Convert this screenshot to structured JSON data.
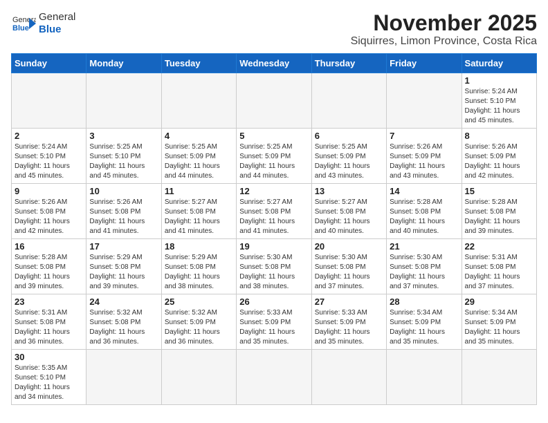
{
  "header": {
    "logo_general": "General",
    "logo_blue": "Blue",
    "month": "November 2025",
    "location": "Siquirres, Limon Province, Costa Rica"
  },
  "weekdays": [
    "Sunday",
    "Monday",
    "Tuesday",
    "Wednesday",
    "Thursday",
    "Friday",
    "Saturday"
  ],
  "rows": [
    [
      {
        "day": "",
        "info": ""
      },
      {
        "day": "",
        "info": ""
      },
      {
        "day": "",
        "info": ""
      },
      {
        "day": "",
        "info": ""
      },
      {
        "day": "",
        "info": ""
      },
      {
        "day": "",
        "info": ""
      },
      {
        "day": "1",
        "info": "Sunrise: 5:24 AM\nSunset: 5:10 PM\nDaylight: 11 hours\nand 45 minutes."
      }
    ],
    [
      {
        "day": "2",
        "info": "Sunrise: 5:24 AM\nSunset: 5:10 PM\nDaylight: 11 hours\nand 45 minutes."
      },
      {
        "day": "3",
        "info": "Sunrise: 5:25 AM\nSunset: 5:10 PM\nDaylight: 11 hours\nand 45 minutes."
      },
      {
        "day": "4",
        "info": "Sunrise: 5:25 AM\nSunset: 5:09 PM\nDaylight: 11 hours\nand 44 minutes."
      },
      {
        "day": "5",
        "info": "Sunrise: 5:25 AM\nSunset: 5:09 PM\nDaylight: 11 hours\nand 44 minutes."
      },
      {
        "day": "6",
        "info": "Sunrise: 5:25 AM\nSunset: 5:09 PM\nDaylight: 11 hours\nand 43 minutes."
      },
      {
        "day": "7",
        "info": "Sunrise: 5:26 AM\nSunset: 5:09 PM\nDaylight: 11 hours\nand 43 minutes."
      },
      {
        "day": "8",
        "info": "Sunrise: 5:26 AM\nSunset: 5:09 PM\nDaylight: 11 hours\nand 42 minutes."
      }
    ],
    [
      {
        "day": "9",
        "info": "Sunrise: 5:26 AM\nSunset: 5:08 PM\nDaylight: 11 hours\nand 42 minutes."
      },
      {
        "day": "10",
        "info": "Sunrise: 5:26 AM\nSunset: 5:08 PM\nDaylight: 11 hours\nand 41 minutes."
      },
      {
        "day": "11",
        "info": "Sunrise: 5:27 AM\nSunset: 5:08 PM\nDaylight: 11 hours\nand 41 minutes."
      },
      {
        "day": "12",
        "info": "Sunrise: 5:27 AM\nSunset: 5:08 PM\nDaylight: 11 hours\nand 41 minutes."
      },
      {
        "day": "13",
        "info": "Sunrise: 5:27 AM\nSunset: 5:08 PM\nDaylight: 11 hours\nand 40 minutes."
      },
      {
        "day": "14",
        "info": "Sunrise: 5:28 AM\nSunset: 5:08 PM\nDaylight: 11 hours\nand 40 minutes."
      },
      {
        "day": "15",
        "info": "Sunrise: 5:28 AM\nSunset: 5:08 PM\nDaylight: 11 hours\nand 39 minutes."
      }
    ],
    [
      {
        "day": "16",
        "info": "Sunrise: 5:28 AM\nSunset: 5:08 PM\nDaylight: 11 hours\nand 39 minutes."
      },
      {
        "day": "17",
        "info": "Sunrise: 5:29 AM\nSunset: 5:08 PM\nDaylight: 11 hours\nand 39 minutes."
      },
      {
        "day": "18",
        "info": "Sunrise: 5:29 AM\nSunset: 5:08 PM\nDaylight: 11 hours\nand 38 minutes."
      },
      {
        "day": "19",
        "info": "Sunrise: 5:30 AM\nSunset: 5:08 PM\nDaylight: 11 hours\nand 38 minutes."
      },
      {
        "day": "20",
        "info": "Sunrise: 5:30 AM\nSunset: 5:08 PM\nDaylight: 11 hours\nand 37 minutes."
      },
      {
        "day": "21",
        "info": "Sunrise: 5:30 AM\nSunset: 5:08 PM\nDaylight: 11 hours\nand 37 minutes."
      },
      {
        "day": "22",
        "info": "Sunrise: 5:31 AM\nSunset: 5:08 PM\nDaylight: 11 hours\nand 37 minutes."
      }
    ],
    [
      {
        "day": "23",
        "info": "Sunrise: 5:31 AM\nSunset: 5:08 PM\nDaylight: 11 hours\nand 36 minutes."
      },
      {
        "day": "24",
        "info": "Sunrise: 5:32 AM\nSunset: 5:08 PM\nDaylight: 11 hours\nand 36 minutes."
      },
      {
        "day": "25",
        "info": "Sunrise: 5:32 AM\nSunset: 5:09 PM\nDaylight: 11 hours\nand 36 minutes."
      },
      {
        "day": "26",
        "info": "Sunrise: 5:33 AM\nSunset: 5:09 PM\nDaylight: 11 hours\nand 35 minutes."
      },
      {
        "day": "27",
        "info": "Sunrise: 5:33 AM\nSunset: 5:09 PM\nDaylight: 11 hours\nand 35 minutes."
      },
      {
        "day": "28",
        "info": "Sunrise: 5:34 AM\nSunset: 5:09 PM\nDaylight: 11 hours\nand 35 minutes."
      },
      {
        "day": "29",
        "info": "Sunrise: 5:34 AM\nSunset: 5:09 PM\nDaylight: 11 hours\nand 35 minutes."
      }
    ],
    [
      {
        "day": "30",
        "info": "Sunrise: 5:35 AM\nSunset: 5:10 PM\nDaylight: 11 hours\nand 34 minutes."
      },
      {
        "day": "",
        "info": ""
      },
      {
        "day": "",
        "info": ""
      },
      {
        "day": "",
        "info": ""
      },
      {
        "day": "",
        "info": ""
      },
      {
        "day": "",
        "info": ""
      },
      {
        "day": "",
        "info": ""
      }
    ]
  ]
}
